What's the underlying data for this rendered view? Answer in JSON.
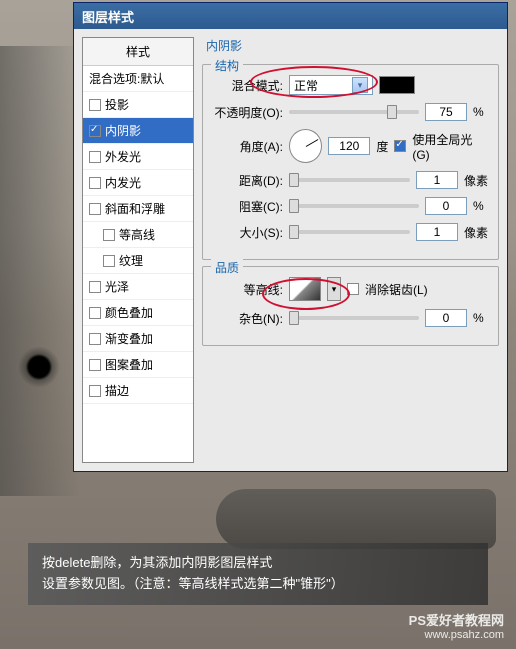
{
  "dialog": {
    "title": "图层样式",
    "section_title": "内阴影"
  },
  "sidebar": {
    "header": "样式",
    "blend_options": "混合选项:默认",
    "items": [
      {
        "label": "投影",
        "checked": false
      },
      {
        "label": "内阴影",
        "checked": true,
        "selected": true
      },
      {
        "label": "外发光",
        "checked": false
      },
      {
        "label": "内发光",
        "checked": false
      },
      {
        "label": "斜面和浮雕",
        "checked": false
      },
      {
        "label": "等高线",
        "checked": false,
        "sub": true
      },
      {
        "label": "纹理",
        "checked": false,
        "sub": true
      },
      {
        "label": "光泽",
        "checked": false
      },
      {
        "label": "颜色叠加",
        "checked": false
      },
      {
        "label": "渐变叠加",
        "checked": false
      },
      {
        "label": "图案叠加",
        "checked": false
      },
      {
        "label": "描边",
        "checked": false
      }
    ]
  },
  "structure": {
    "legend": "结构",
    "blend_mode_label": "混合模式:",
    "blend_mode_value": "正常",
    "opacity_label": "不透明度(O):",
    "opacity_value": "75",
    "opacity_unit": "%",
    "angle_label": "角度(A):",
    "angle_value": "120",
    "angle_unit": "度",
    "global_light_label": "使用全局光(G)",
    "distance_label": "距离(D):",
    "distance_value": "1",
    "distance_unit": "像素",
    "choke_label": "阻塞(C):",
    "choke_value": "0",
    "choke_unit": "%",
    "size_label": "大小(S):",
    "size_value": "1",
    "size_unit": "像素"
  },
  "quality": {
    "legend": "品质",
    "contour_label": "等高线:",
    "antialias_label": "消除锯齿(L)",
    "noise_label": "杂色(N):",
    "noise_value": "0",
    "noise_unit": "%"
  },
  "caption": {
    "line1": "按delete删除，为其添加内阴影图层样式",
    "line2": "设置参数见图。（注意：等高线样式选第二种\"锥形\"）"
  },
  "watermark": {
    "line1": "PS爱好者教程网",
    "line2": "www.psahz.com"
  }
}
